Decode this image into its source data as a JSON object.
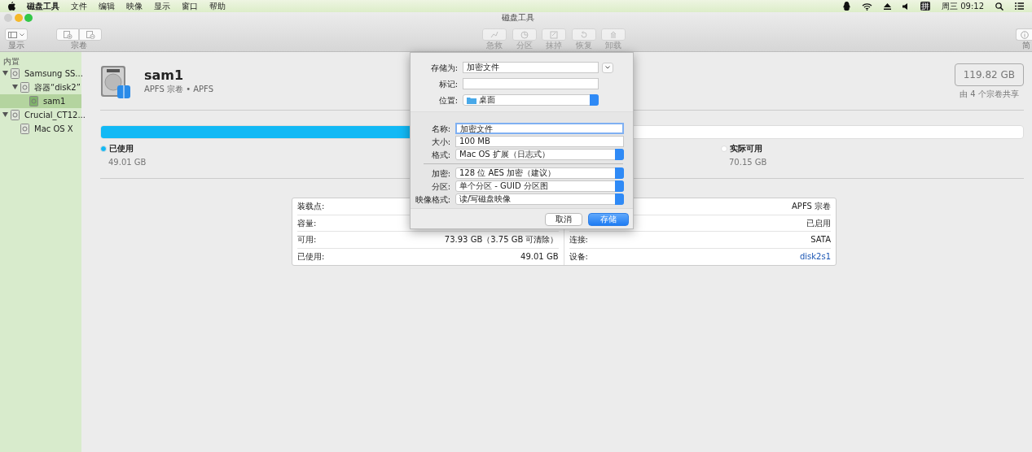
{
  "menubar": {
    "items": [
      "磁盘工具",
      "文件",
      "编辑",
      "映像",
      "显示",
      "窗口",
      "帮助"
    ],
    "input_method": "拼",
    "clock": "周三 09:12"
  },
  "window": {
    "title": "磁盘工具",
    "view_label": "显示",
    "volume_label": "宗卷",
    "actions": [
      {
        "label": "急救",
        "disabled": true
      },
      {
        "label": "分区",
        "disabled": true
      },
      {
        "label": "抹掉",
        "disabled": true
      },
      {
        "label": "恢复",
        "disabled": true
      },
      {
        "label": "卸载",
        "disabled": true
      }
    ],
    "info_label": "简"
  },
  "sidebar": {
    "header": "内置",
    "items": [
      {
        "label": "Samsung SS...",
        "expanded": true,
        "selected": false,
        "children": [
          {
            "label": "容器“disk2”",
            "expanded": true,
            "selected": false,
            "children": [
              {
                "label": "sam1",
                "selected": true
              }
            ]
          }
        ]
      },
      {
        "label": "Crucial_CT12...",
        "expanded": true,
        "selected": false,
        "children": [
          {
            "label": "Mac OS X",
            "selected": false
          }
        ]
      }
    ]
  },
  "volume": {
    "name": "sam1",
    "subtitle": "APFS 宗卷 • APFS",
    "capacity": "119.82 GB",
    "shared_note": "由 4 个宗卷共享"
  },
  "usage": {
    "level": 0.41,
    "legend": [
      {
        "label": "已使用",
        "value": "49.01 GB",
        "color": "#12b9f5"
      },
      {
        "label": "实际可用",
        "value": "70.15 GB",
        "color": "#ffffff"
      }
    ]
  },
  "info_table": {
    "left": [
      {
        "label": "装载点:"
      },
      {
        "label": "容量:"
      },
      {
        "label": "可用:",
        "value": "73.93 GB（3.75 GB 可清除）"
      },
      {
        "label": "已使用:",
        "value": "49.01 GB"
      }
    ],
    "right": [
      {
        "value": "APFS 宗卷"
      },
      {
        "value": "已启用"
      },
      {
        "label": "连接:",
        "value": "SATA"
      },
      {
        "label": "设备:",
        "value": "disk2s1",
        "link": true
      }
    ]
  },
  "dialog": {
    "save_as": {
      "label": "存储为:",
      "value": "加密文件"
    },
    "tags": {
      "label": "标记:"
    },
    "where": {
      "label": "位置:",
      "value": "桌面"
    },
    "fields": [
      {
        "label": "名称:",
        "value": "加密文件",
        "kind": "text",
        "focused": true
      },
      {
        "label": "大小:",
        "value": "100 MB",
        "kind": "text",
        "focused": false
      },
      {
        "label": "格式:",
        "value": "Mac OS 扩展（日志式）",
        "kind": "select"
      },
      {
        "kind": "divider"
      },
      {
        "label": "加密:",
        "value": "128 位 AES 加密（建议）",
        "kind": "select"
      },
      {
        "label": "分区:",
        "value": "单个分区 - GUID 分区图",
        "kind": "select"
      },
      {
        "label": "映像格式:",
        "value": "读/写磁盘映像",
        "kind": "select"
      }
    ],
    "buttons": [
      {
        "label": "取消",
        "primary": false
      },
      {
        "label": "存储",
        "primary": true
      }
    ]
  }
}
